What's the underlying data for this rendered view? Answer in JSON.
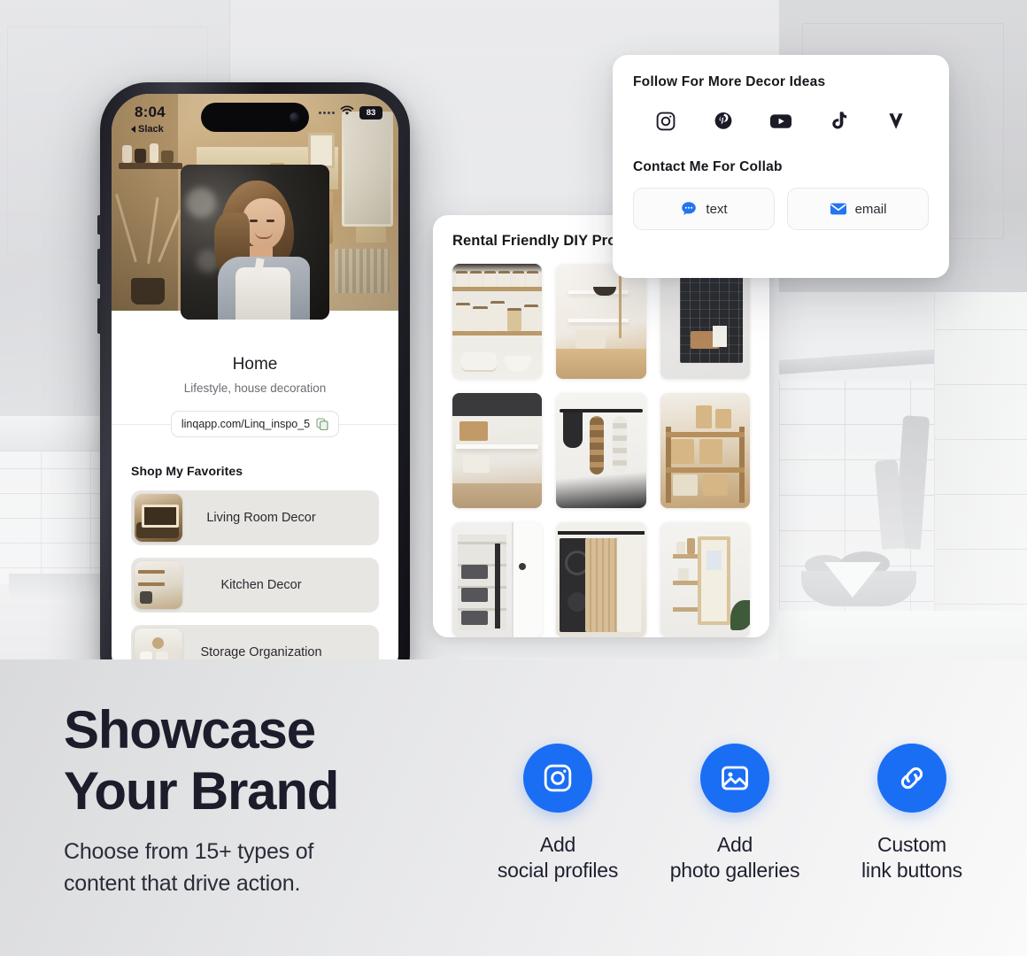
{
  "phone": {
    "status_bar": {
      "time": "8:04",
      "back_app": "Slack",
      "battery": "83",
      "wifi_icon": "wifi-icon",
      "signal_icon": "signal-dots-icon"
    },
    "profile": {
      "name": "Home",
      "tagline": "Lifestyle, house decoration",
      "url": "linqapp.com/Linq_inspo_5",
      "copy_icon": "copy-icon",
      "avatar_alt": "profile-photo"
    },
    "favorites": {
      "section_title": "Shop My Favorites",
      "items": [
        {
          "label": "Living Room Decor",
          "thumb": "living-room-thumb"
        },
        {
          "label": "Kitchen Decor",
          "thumb": "kitchen-thumb"
        },
        {
          "label": "Storage Organization",
          "thumb": "storage-thumb"
        }
      ]
    }
  },
  "gallery_card": {
    "title": "Rental Friendly DIY Proj",
    "photos": [
      "pantry-shelves-jars",
      "kitchen-open-shelving",
      "black-pegboard-wall",
      "under-shelf-storage",
      "hanging-rail-baskets",
      "wooden-console-baskets",
      "closet-cleaning-storage",
      "barn-door-laundry",
      "corner-wall-shelf"
    ]
  },
  "contact_card": {
    "follow_title": "Follow For More Decor Ideas",
    "socials": [
      {
        "name": "instagram-icon",
        "label": "Instagram"
      },
      {
        "name": "pinterest-icon",
        "label": "Pinterest"
      },
      {
        "name": "youtube-icon",
        "label": "YouTube"
      },
      {
        "name": "tiktok-icon",
        "label": "TikTok"
      },
      {
        "name": "vimeo-icon",
        "label": "Vimeo"
      }
    ],
    "contact_title": "Contact Me For Collab",
    "buttons": [
      {
        "label": "text",
        "icon": "message-bubble-icon"
      },
      {
        "label": "email",
        "icon": "envelope-icon"
      }
    ]
  },
  "promo": {
    "headline_line1": "Showcase",
    "headline_line2": "Your Brand",
    "subhead_line1": "Choose from 15+ types of",
    "subhead_line2": "content that drive action.",
    "features": [
      {
        "icon": "instagram-icon",
        "line1": "Add",
        "line2": "social profiles"
      },
      {
        "icon": "photo-image-icon",
        "line1": "Add",
        "line2": "photo galleries"
      },
      {
        "icon": "link-chain-icon",
        "line1": "Custom",
        "line2": "link buttons"
      }
    ]
  },
  "colors": {
    "accent_blue": "#1a6ef4",
    "dark_text": "#1b1d2b",
    "muted_text": "#6c6c74",
    "card_white": "#ffffff",
    "list_item_bg": "#e7e6e2"
  }
}
